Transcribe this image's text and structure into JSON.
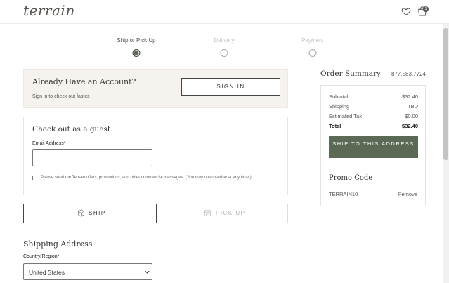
{
  "header": {
    "logo": "terrain",
    "bag_count": "1"
  },
  "steps": [
    {
      "label": "Ship or Pick Up"
    },
    {
      "label": "Delivery"
    },
    {
      "label": "Payment"
    }
  ],
  "account": {
    "title": "Already Have an Account?",
    "subtitle": "Sign in to check out faster.",
    "sign_in_label": "SIGN IN"
  },
  "guest": {
    "title": "Check out as a guest",
    "email_label": "Email Address*",
    "email_value": "",
    "consent_text": "Please send me Terrain offers, promotions, and other commercial messages. (You may unsubscribe at any time.)"
  },
  "fulfillment": {
    "ship_label": "SHIP",
    "pickup_label": "PICK UP"
  },
  "shipping": {
    "title": "Shipping Address",
    "country_label": "Country/Region*",
    "country_value": "United States"
  },
  "summary": {
    "title": "Order Summary",
    "phone": "877.583.7724",
    "rows": [
      {
        "label": "Subtotal",
        "value": "$32.40"
      },
      {
        "label": "Shipping",
        "value": "TBD"
      },
      {
        "label": "Estimated Tax",
        "value": "$0.00"
      },
      {
        "label": "Total",
        "value": "$32.40"
      }
    ],
    "ship_button": "SHIP TO THIS ADDRESS",
    "promo_title": "Promo Code",
    "promo_code": "TERRAIN10",
    "remove_label": "Remove"
  },
  "colors": {
    "accent": "#5b6a55",
    "panel_bg": "#f6f3ef"
  }
}
